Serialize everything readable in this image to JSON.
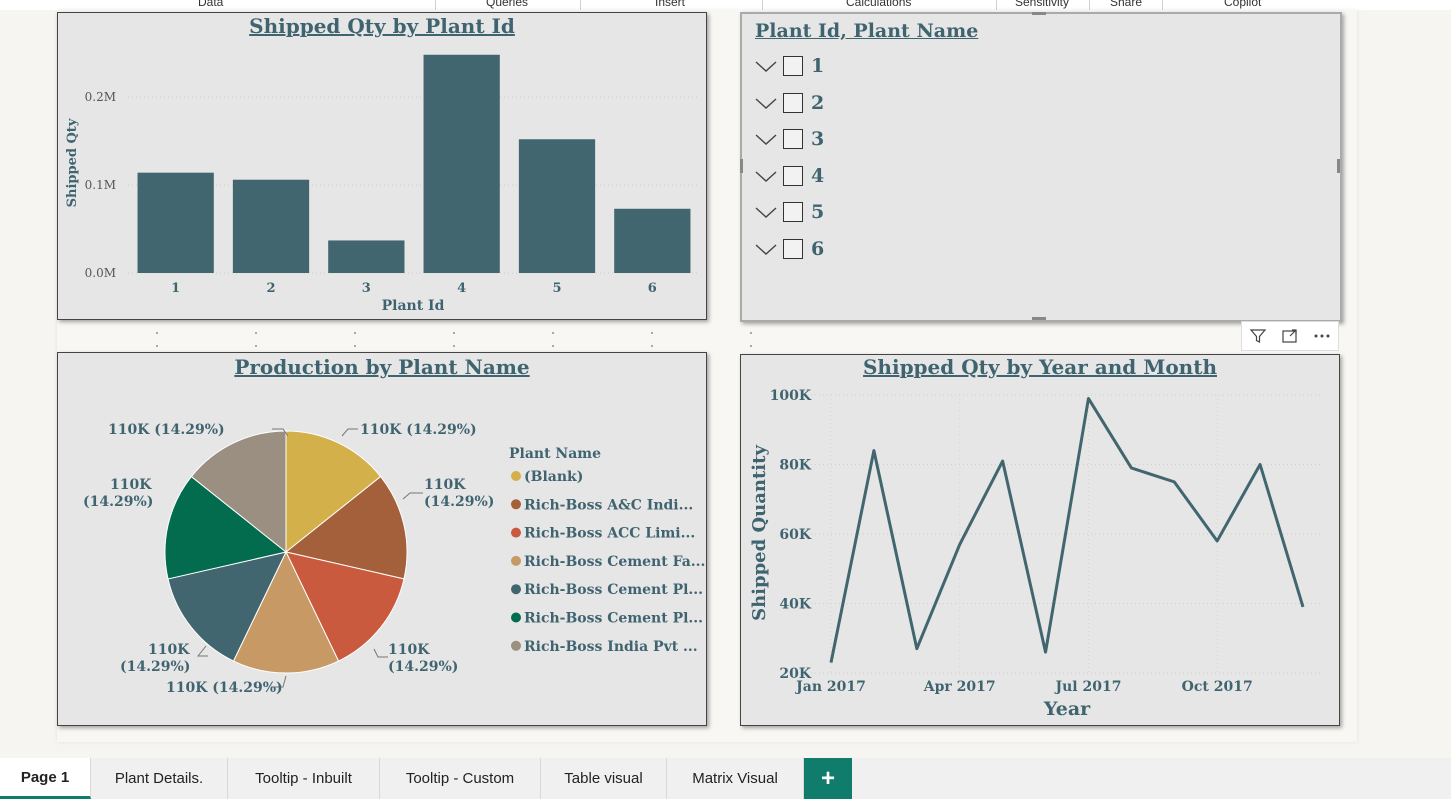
{
  "ribbon": {
    "groups": [
      "Data",
      "Queries",
      "Insert",
      "Calculations",
      "Sensitivity",
      "Share",
      "Copilot"
    ]
  },
  "bar_visual": {
    "title": "Shipped Qty by Plant Id",
    "xlabel": "Plant Id",
    "ylabel": "Shipped Qty",
    "y_ticks": [
      "0.0M",
      "0.1M",
      "0.2M"
    ]
  },
  "slicer": {
    "title": "Plant Id, Plant Name",
    "items": [
      "1",
      "2",
      "3",
      "4",
      "5",
      "6"
    ]
  },
  "visual_toolbar": {
    "icons": [
      "filter-icon",
      "focus-mode-icon",
      "more-options-icon"
    ]
  },
  "pie_visual": {
    "title": "Production by Plant Name",
    "legend_title": "Plant Name",
    "legend_items": [
      "(Blank)",
      "Rich-Boss A&C Indi...",
      "Rich-Boss ACC Limi...",
      "Rich-Boss Cement Fa...",
      "Rich-Boss Cement Pl...",
      "Rich-Boss Cement Pl...",
      "Rich-Boss India Pvt ..."
    ],
    "slice_labels": [
      "110K (14.29%)",
      "110K (14.29%)",
      "110K (14.29%)",
      "110K (14.29%)",
      "110K (14.29%)",
      "110K (14.29%)",
      "110K (14.29%)"
    ]
  },
  "line_visual": {
    "title": "Shipped Qty by Year and Month",
    "xlabel": "Year",
    "ylabel": "Shipped Quantity",
    "y_ticks": [
      "20K",
      "40K",
      "60K",
      "80K",
      "100K"
    ],
    "x_ticks": [
      "Jan 2017",
      "Apr 2017",
      "Jul 2017",
      "Oct 2017"
    ]
  },
  "tabs": [
    "Page 1",
    "Plant Details.",
    "Tooltip - Inbuilt",
    "Tooltip - Custom",
    "Table visual",
    "Matrix Visual"
  ],
  "add_tab_label": "+",
  "colors": {
    "bar": "#41666f",
    "title": "#3f6470",
    "accent": "#107c6b",
    "pie": [
      "#d4b04a",
      "#a4603a",
      "#c95a3e",
      "#c79a65",
      "#41666f",
      "#036c4e",
      "#9b8f82"
    ]
  },
  "chart_data": [
    {
      "type": "bar",
      "title": "Shipped Qty by Plant Id",
      "xlabel": "Plant Id",
      "ylabel": "Shipped Qty",
      "categories": [
        "1",
        "2",
        "3",
        "4",
        "5",
        "6"
      ],
      "values": [
        114000,
        106000,
        37000,
        248000,
        152000,
        73000
      ],
      "ylim": [
        0,
        250000
      ],
      "y_ticks": [
        0,
        100000,
        200000
      ],
      "grid": true
    },
    {
      "type": "pie",
      "title": "Production by Plant Name",
      "categories": [
        "(Blank)",
        "Rich-Boss A&C Indi...",
        "Rich-Boss ACC Limi...",
        "Rich-Boss Cement Fa...",
        "Rich-Boss Cement Pl...",
        "Rich-Boss Cement Pl...",
        "Rich-Boss India Pvt ..."
      ],
      "values": [
        110000,
        110000,
        110000,
        110000,
        110000,
        110000,
        110000
      ],
      "percentages": [
        14.29,
        14.29,
        14.29,
        14.29,
        14.29,
        14.29,
        14.29
      ],
      "legend": "right"
    },
    {
      "type": "line",
      "title": "Shipped Qty by Year and Month",
      "xlabel": "Year",
      "ylabel": "Shipped Quantity",
      "x": [
        "2017-01",
        "2017-02",
        "2017-03",
        "2017-04",
        "2017-05",
        "2017-06",
        "2017-07",
        "2017-08",
        "2017-09",
        "2017-10",
        "2017-11",
        "2017-12"
      ],
      "y": [
        23000,
        84000,
        27000,
        57000,
        81000,
        26000,
        99000,
        79000,
        75000,
        58000,
        80000,
        39000
      ],
      "ylim": [
        20000,
        100000
      ],
      "y_ticks": [
        20000,
        40000,
        60000,
        80000,
        100000
      ],
      "grid": true
    }
  ]
}
